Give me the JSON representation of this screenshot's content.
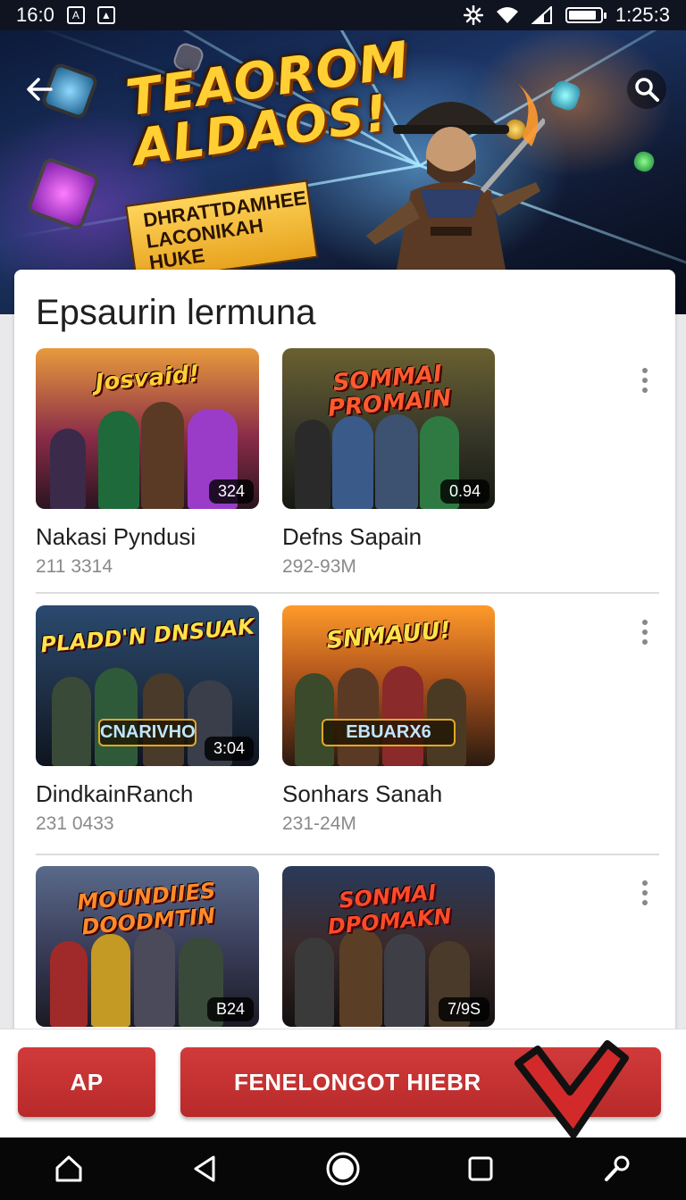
{
  "status_bar": {
    "time_left": "16:0",
    "time_right": "1:25:3",
    "battery_level": 0.9
  },
  "hero": {
    "title_line1": "TEAOROM",
    "title_line2": "ALDAOS!",
    "ribbon_line1": "DHRATTDAMHEE",
    "ribbon_line2": "LACONIKAH HUKE",
    "back_icon": "arrow-left-icon",
    "search_icon": "search-icon"
  },
  "section": {
    "title": "Epsaurin lermuna"
  },
  "games": [
    {
      "thumb_title": "Josvaid!",
      "badge": "324",
      "name": "Nakasi Pyndusi",
      "meta": "211 3314",
      "accent": "#c73a8b"
    },
    {
      "thumb_title": "SOMMAI PROMAIN",
      "badge": "0.94",
      "name": "Defns Sapain",
      "meta": "292-93M",
      "accent": "#3f6f3a"
    },
    {
      "thumb_title": "PLADD'N DNSUAK",
      "badge": "3:04",
      "name": "DindkainRanch",
      "meta": "231 0433",
      "thumb_sub": "CNARIVHO",
      "accent": "#2b4e6b"
    },
    {
      "thumb_title": "SNMAUU!",
      "badge": "",
      "name": "Sonhars Sanah",
      "meta": "231-24M",
      "thumb_sub": "EBUARX6",
      "accent": "#b8631e"
    },
    {
      "thumb_title": "MOUNDIIES DOODMTIN",
      "badge": "B24",
      "name": "",
      "meta": "",
      "accent": "#3b4a6e"
    },
    {
      "thumb_title": "SONMAI DPOMAKN",
      "badge": "7/9S",
      "name": "",
      "meta": "",
      "accent": "#4b3a2e"
    }
  ],
  "actions": {
    "secondary_label": "AP",
    "primary_label": "FENELONGOT HIEBR"
  },
  "nav": {
    "home_icon": "home-icon",
    "back_icon": "back-triangle-icon",
    "center_icon": "circle-home-icon",
    "recents_icon": "recents-square-icon",
    "tool_icon": "wrench-icon"
  },
  "colors": {
    "primary_red": "#c33232",
    "status_bar": "#101421",
    "nav_bar": "#070707"
  }
}
